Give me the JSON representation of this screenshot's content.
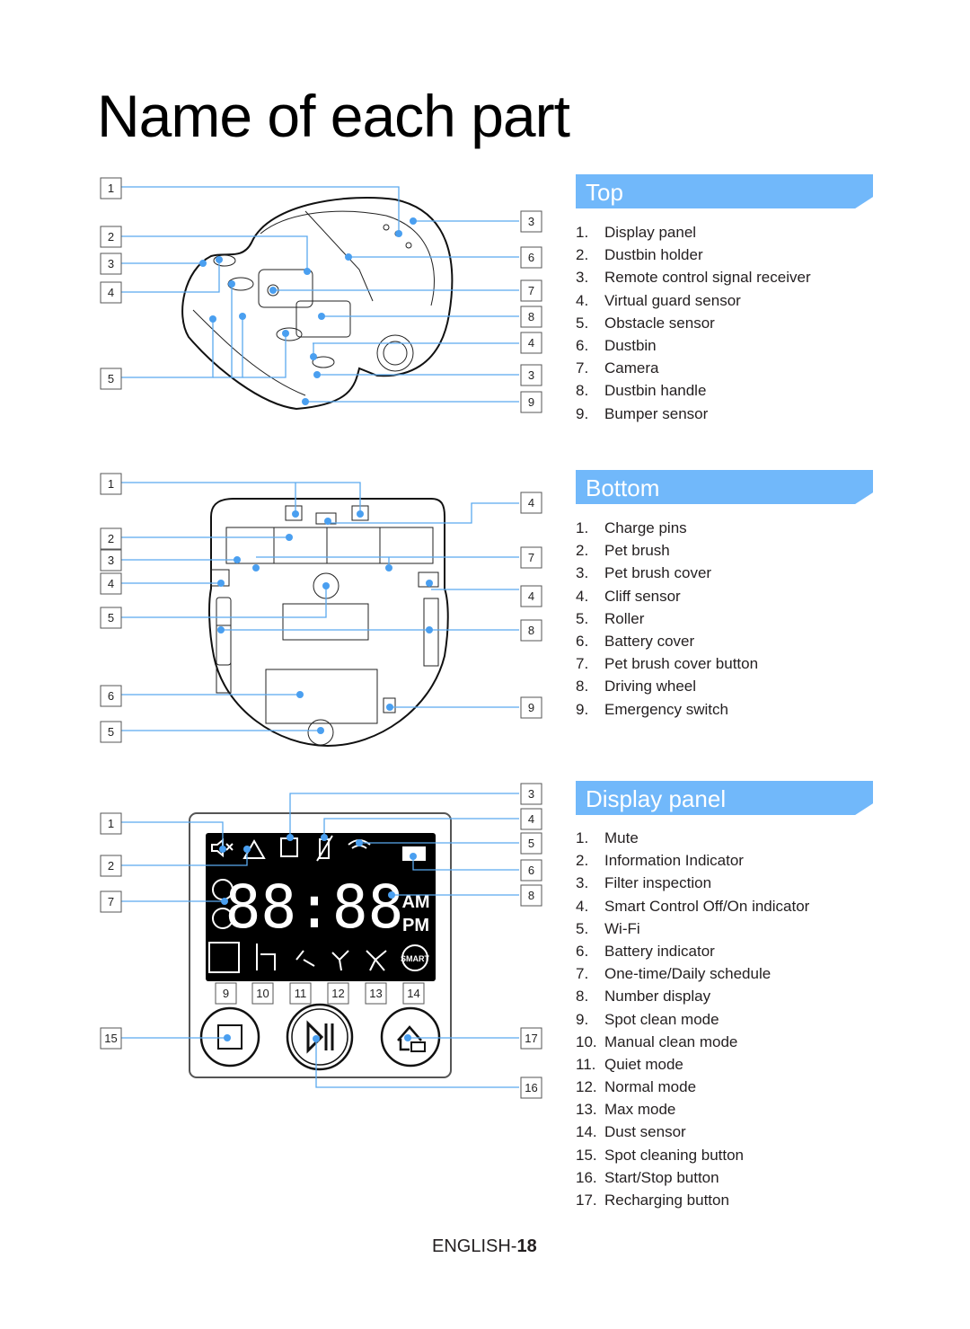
{
  "page": {
    "title": "Name of each part",
    "footer_language": "ENGLISH-",
    "footer_page": "18"
  },
  "sections": {
    "top": {
      "header": "Top",
      "items": [
        {
          "num": "1.",
          "label": "Display panel"
        },
        {
          "num": "2.",
          "label": "Dustbin holder"
        },
        {
          "num": "3.",
          "label": "Remote control signal receiver"
        },
        {
          "num": "4.",
          "label": "Virtual guard sensor"
        },
        {
          "num": "5.",
          "label": "Obstacle sensor"
        },
        {
          "num": "6.",
          "label": "Dustbin"
        },
        {
          "num": "7.",
          "label": "Camera"
        },
        {
          "num": "8.",
          "label": "Dustbin handle"
        },
        {
          "num": "9.",
          "label": "Bumper sensor"
        }
      ],
      "callouts_left": [
        "1",
        "2",
        "3",
        "4",
        "5"
      ],
      "callouts_right": [
        "3",
        "6",
        "7",
        "8",
        "4",
        "3",
        "9"
      ]
    },
    "bottom": {
      "header": "Bottom",
      "items": [
        {
          "num": "1.",
          "label": "Charge pins"
        },
        {
          "num": "2.",
          "label": "Pet brush"
        },
        {
          "num": "3.",
          "label": "Pet brush cover"
        },
        {
          "num": "4.",
          "label": "Cliff sensor"
        },
        {
          "num": "5.",
          "label": "Roller"
        },
        {
          "num": "6.",
          "label": "Battery cover"
        },
        {
          "num": "7.",
          "label": "Pet brush cover button"
        },
        {
          "num": "8.",
          "label": "Driving wheel"
        },
        {
          "num": "9.",
          "label": "Emergency switch"
        }
      ],
      "callouts_left": [
        "1",
        "2",
        "3",
        "4",
        "5",
        "6",
        "5"
      ],
      "callouts_right": [
        "4",
        "7",
        "4",
        "8",
        "9"
      ]
    },
    "display": {
      "header": "Display panel",
      "items": [
        {
          "num": "1.",
          "label": "Mute"
        },
        {
          "num": "2.",
          "label": "Information Indicator"
        },
        {
          "num": "3.",
          "label": "Filter inspection"
        },
        {
          "num": "4.",
          "label": "Smart Control Off/On indicator"
        },
        {
          "num": "5.",
          "label": "Wi-Fi"
        },
        {
          "num": "6.",
          "label": "Battery indicator"
        },
        {
          "num": "7.",
          "label": "One-time/Daily schedule"
        },
        {
          "num": "8.",
          "label": "Number display"
        },
        {
          "num": "9.",
          "label": "Spot clean mode"
        },
        {
          "num": "10.",
          "label": "Manual clean mode"
        },
        {
          "num": "11.",
          "label": "Quiet mode"
        },
        {
          "num": "12.",
          "label": "Normal mode"
        },
        {
          "num": "13.",
          "label": "Max mode"
        },
        {
          "num": "14.",
          "label": "Dust sensor"
        },
        {
          "num": "15.",
          "label": "Spot cleaning button"
        },
        {
          "num": "16.",
          "label": "Start/Stop button"
        },
        {
          "num": "17.",
          "label": "Recharging button"
        }
      ],
      "callouts_left": [
        "1",
        "2",
        "7",
        "15"
      ],
      "callouts_right": [
        "3",
        "4",
        "5",
        "6",
        "8",
        "17",
        "16"
      ],
      "callouts_bottom": [
        "9",
        "10",
        "11",
        "12",
        "13",
        "14"
      ],
      "lcd_digits": "88:88",
      "lcd_am": "AM",
      "lcd_pm": "PM",
      "lcd_smart": "SMART"
    }
  },
  "colors": {
    "header_bg": "#71b8fa",
    "leader_line": "#5aa9ef",
    "lcd_bg": "#000000"
  }
}
